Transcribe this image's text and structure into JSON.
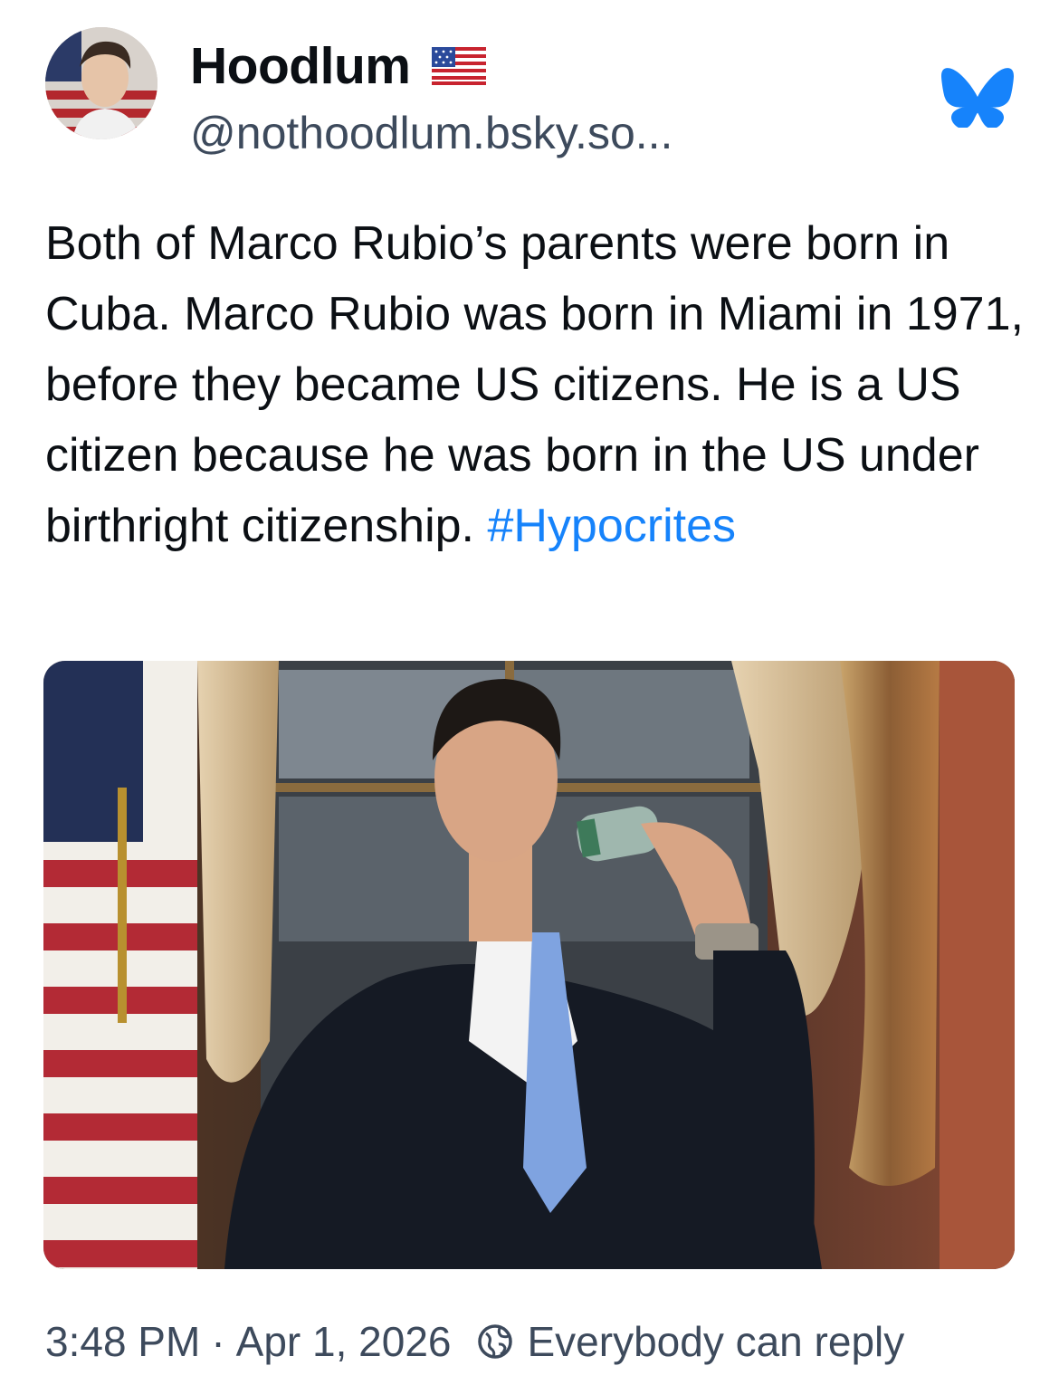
{
  "author": {
    "display_name": "Hoodlum",
    "handle": "@nothoodlum.bsky.so...",
    "avatar_icon": "avatar",
    "flag_icon": "us-flag-icon"
  },
  "platform_icon": "bluesky-butterfly-icon",
  "brand_color": "#1683fb",
  "post": {
    "text": "Both of Marco Rubio’s parents were born in Cuba. Marco Rubio was born in Miami in 1971, before they became US citizens. He is a US citizen because he was born in the US under birthright citizenship. ",
    "hashtag": "#Hypocrites"
  },
  "media": {
    "icon": "post-photo"
  },
  "meta": {
    "time": "3:48 PM",
    "separator": "·",
    "date": "Apr 1, 2026",
    "reply_setting": "Everybody can reply",
    "reply_icon": "globe-icon"
  }
}
